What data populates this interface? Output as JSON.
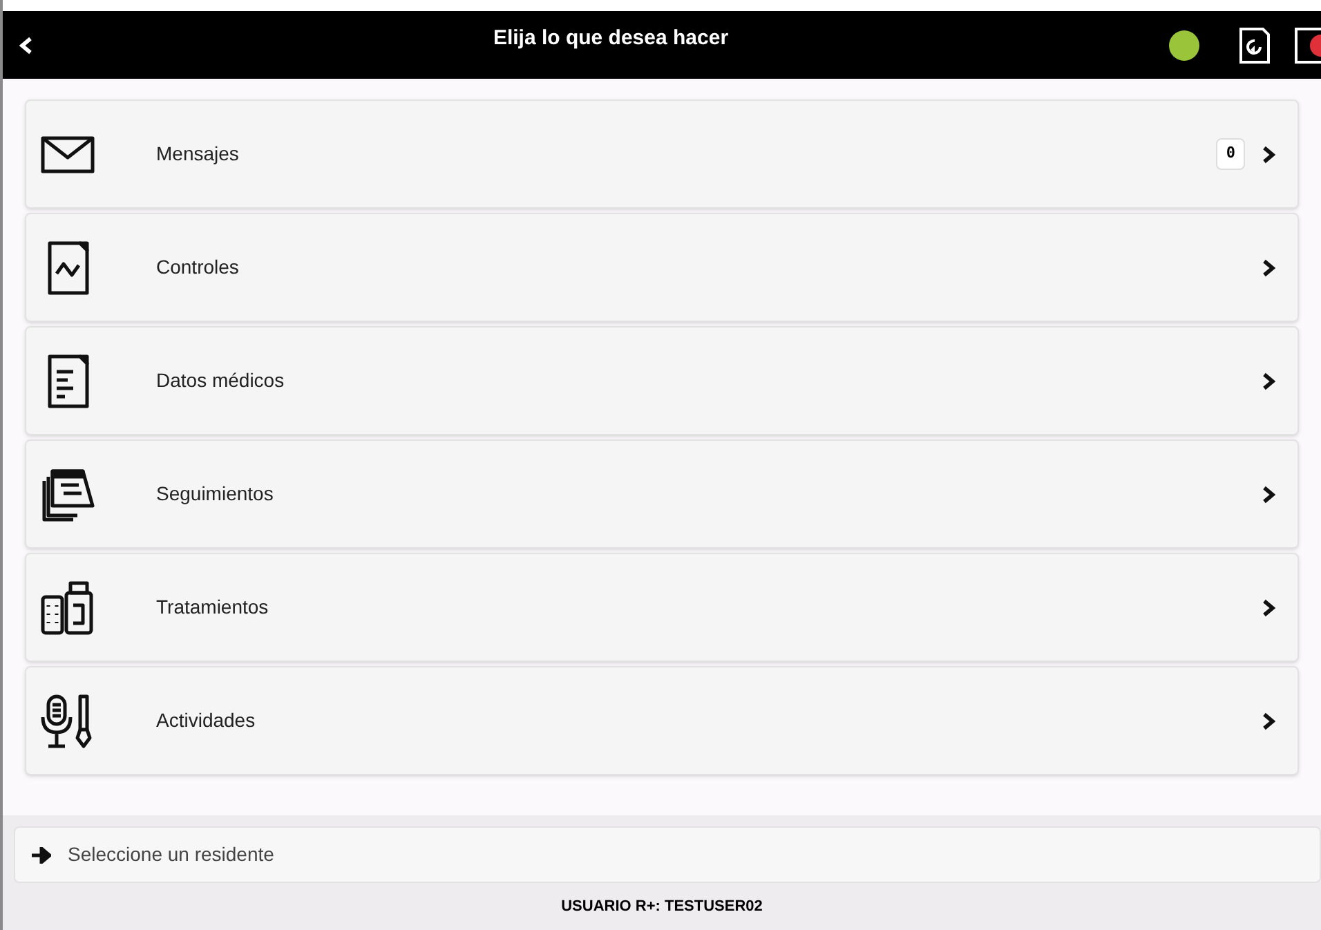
{
  "header": {
    "title": "Elija lo que desea hacer",
    "connected": true
  },
  "menu": [
    {
      "label": "Mensajes",
      "badge": "0"
    },
    {
      "label": "Controles"
    },
    {
      "label": "Datos médicos"
    },
    {
      "label": "Seguimientos"
    },
    {
      "label": "Tratamientos"
    },
    {
      "label": "Actividades"
    }
  ],
  "resident_field": {
    "placeholder": "Seleccione un residente"
  },
  "footer": {
    "user": "USUARIO R+: TESTUSER02"
  }
}
